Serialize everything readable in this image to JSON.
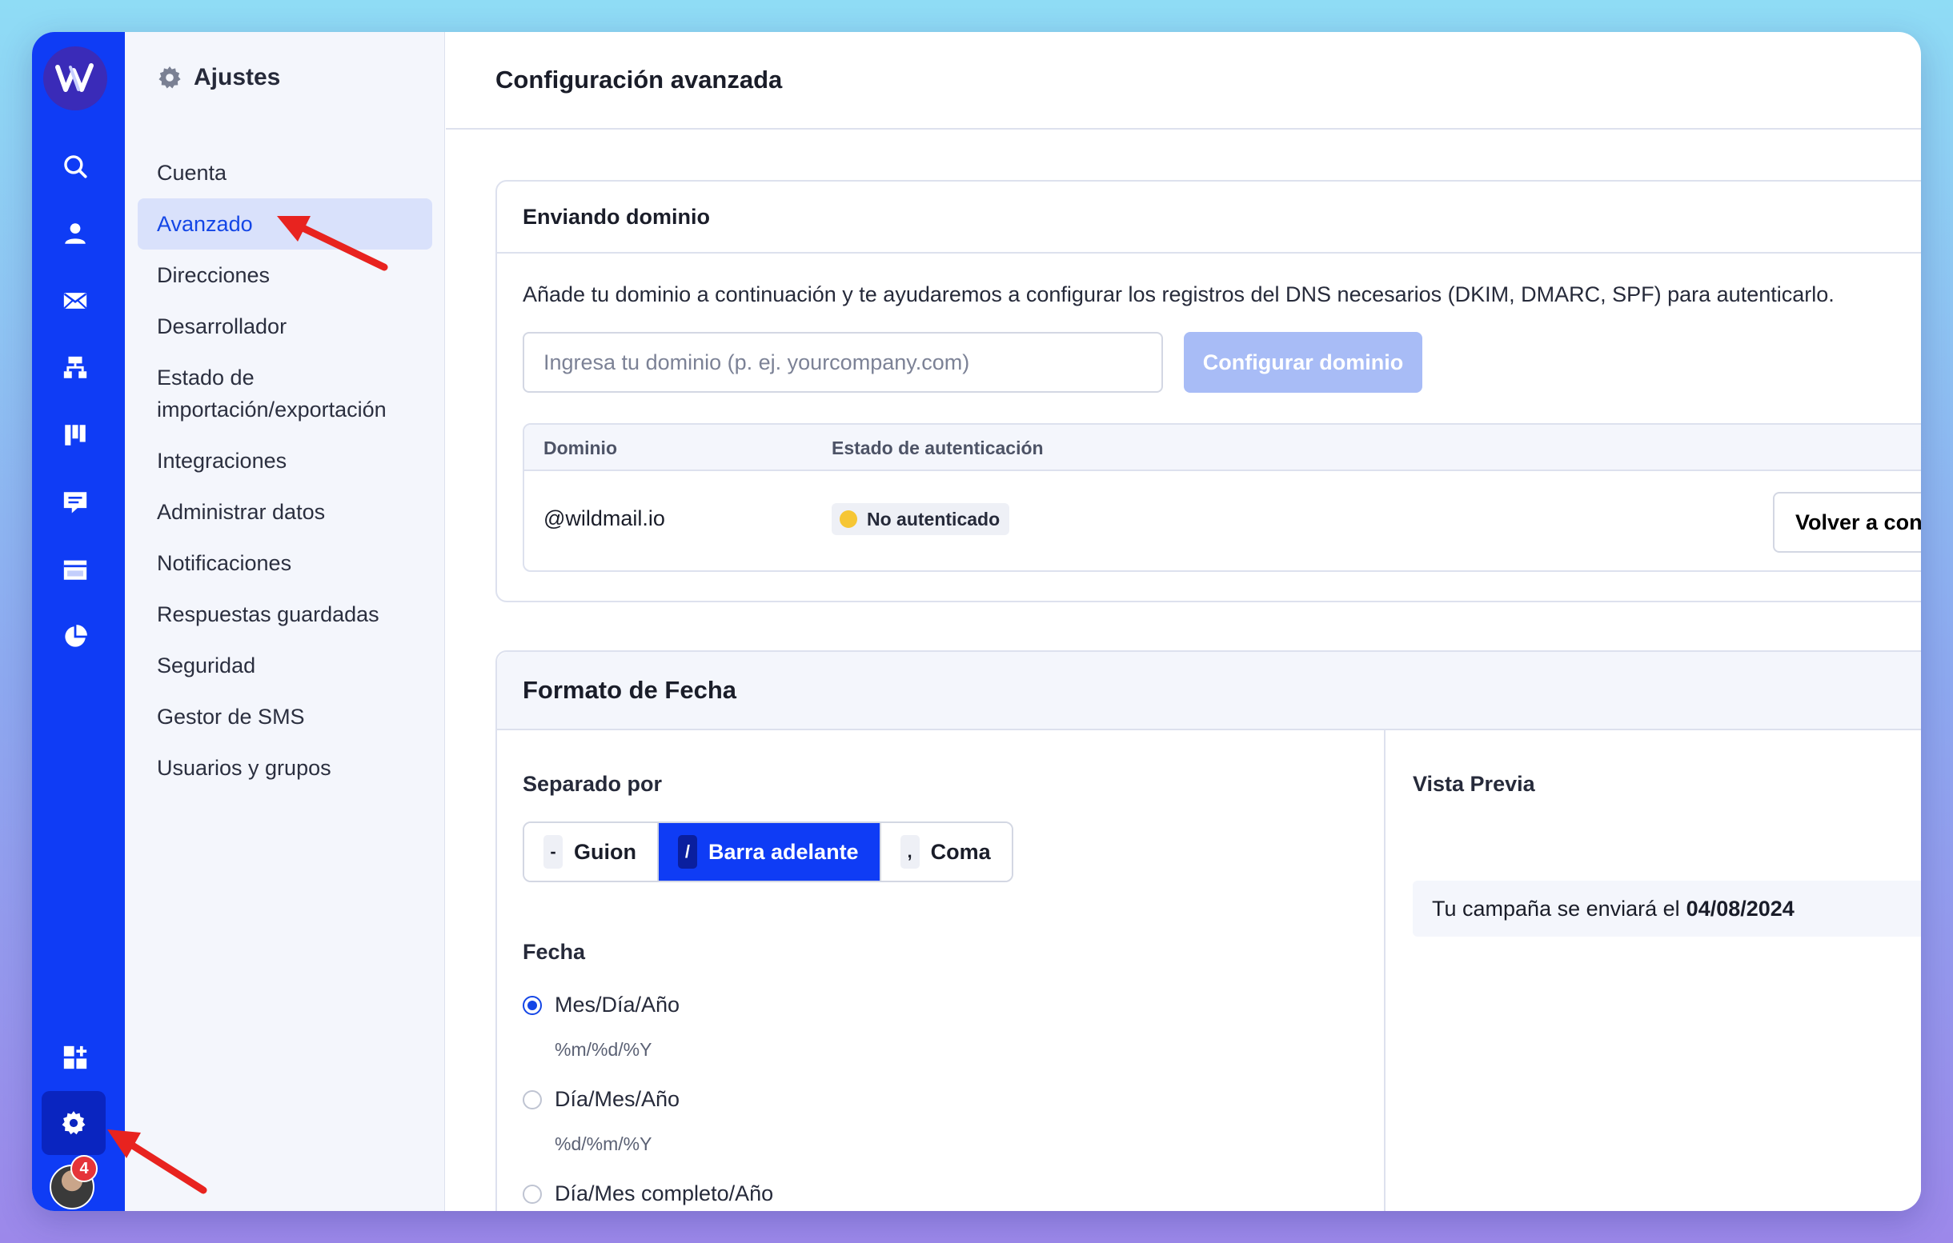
{
  "logo": {
    "text": "W"
  },
  "rail": {
    "items": [
      {
        "icon": "search-icon"
      },
      {
        "icon": "user-icon"
      },
      {
        "icon": "mail-icon"
      },
      {
        "icon": "sitemap-icon"
      },
      {
        "icon": "kanban-icon"
      },
      {
        "icon": "chat-icon"
      },
      {
        "icon": "calendar-icon"
      },
      {
        "icon": "pie-chart-icon"
      }
    ],
    "apps_icon": "apps-add-icon",
    "settings_icon": "gear-icon",
    "notifications_count": "4"
  },
  "settings": {
    "title": "Ajustes",
    "items": [
      {
        "label": "Cuenta"
      },
      {
        "label": "Avanzado"
      },
      {
        "label": "Direcciones"
      },
      {
        "label": "Desarrollador"
      },
      {
        "label": "Estado de importación/exportación"
      },
      {
        "label": "Integraciones"
      },
      {
        "label": "Administrar datos"
      },
      {
        "label": "Notificaciones"
      },
      {
        "label": "Respuestas guardadas"
      },
      {
        "label": "Seguridad"
      },
      {
        "label": "Gestor de SMS"
      },
      {
        "label": "Usuarios y grupos"
      }
    ],
    "active_index": 1
  },
  "main": {
    "title": "Configuración avanzada",
    "sending_domain": {
      "title": "Enviando dominio",
      "description": "Añade tu dominio a continuación y te ayudaremos a configurar los registros del DNS necesarios (DKIM, DMARC, SPF) para autenticarlo.",
      "input_placeholder": "Ingresa tu dominio (p. ej. yourcompany.com)",
      "input_value": "",
      "configure_button": "Configurar dominio",
      "table": {
        "columns": [
          "Dominio",
          "Estado de autenticación"
        ],
        "rows": [
          {
            "domain": "@wildmail.io",
            "status": "No autenticado",
            "action": "Volver a con"
          }
        ]
      }
    },
    "date_format": {
      "title": "Formato de Fecha",
      "separator_label": "Separado por",
      "separators": [
        {
          "key": "-",
          "label": "Guion"
        },
        {
          "key": "/",
          "label": "Barra adelante"
        },
        {
          "key": ",",
          "label": "Coma"
        }
      ],
      "selected_separator": 1,
      "date_label": "Fecha",
      "options": [
        {
          "label": "Mes/Día/Año",
          "format": "%m/%d/%Y"
        },
        {
          "label": "Día/Mes/Año",
          "format": "%d/%m/%Y"
        },
        {
          "label": "Día/Mes completo/Año",
          "format": ""
        }
      ],
      "selected_option": 0,
      "preview_label": "Vista Previa",
      "preview_text": "Tu campaña se enviará el",
      "preview_date": "04/08/2024"
    }
  },
  "colors": {
    "rail": "#0f3cf5",
    "accent": "#1446e6",
    "disabled_button": "#a8bcf6",
    "status_dot": "#f6c634",
    "badge": "#e5343a",
    "annotation_arrow": "#e8231f"
  }
}
